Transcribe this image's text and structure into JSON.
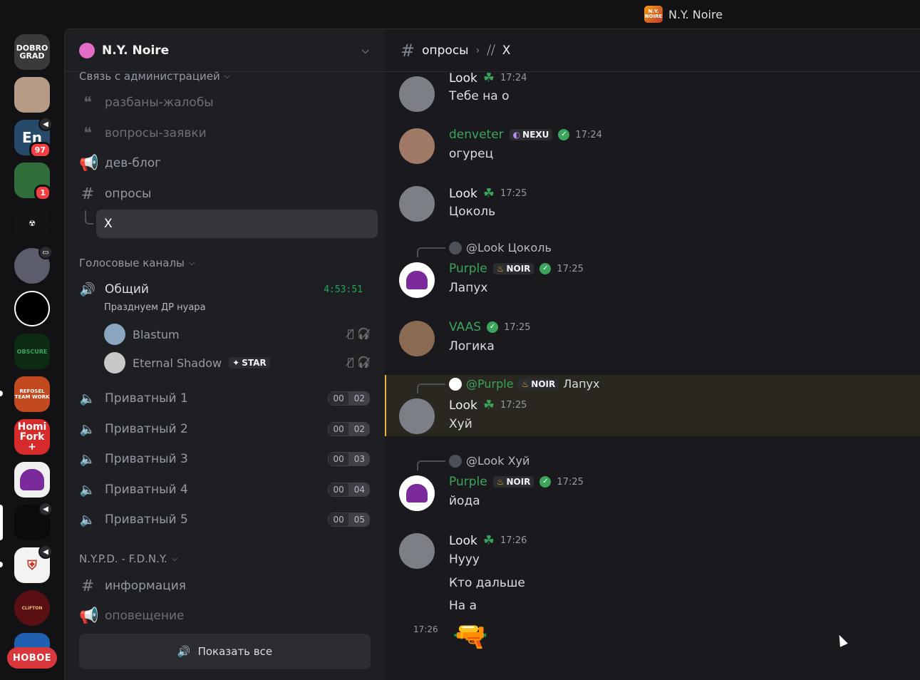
{
  "window": {
    "title": "N.Y. Noire"
  },
  "guilds": [
    {
      "label": "DOBRO GRAD",
      "color": "#3a3a3a"
    },
    {
      "label": "",
      "color": "#b59a86"
    },
    {
      "label": "En",
      "color": "#274a6b",
      "badge": "97",
      "speaker": true
    },
    {
      "label": "",
      "color": "#2f6d3a",
      "badge": "1"
    },
    {
      "label": "",
      "color": "#141414"
    },
    {
      "label": "",
      "color": "#5b5d6d",
      "speaker": true
    },
    {
      "label": "",
      "color": "#000000"
    },
    {
      "label": "OBSCURE",
      "color": "#0d2a12"
    },
    {
      "label": "REFOSEL TEAM WORK",
      "color": "#c34a1f"
    },
    {
      "label": "Homi Fork +",
      "color": "#d72b2b"
    },
    {
      "label": "",
      "color": "#f0f0f0"
    },
    {
      "label": "",
      "color": "#0b0b0b",
      "speaker": true
    },
    {
      "label": "",
      "color": "#f3f3f3",
      "speaker": true
    },
    {
      "label": "CLIFTON",
      "color": "#5a0f12"
    },
    {
      "label": "",
      "color": "#1f5fb0"
    }
  ],
  "new_button": "НОВОЕ",
  "server": {
    "name": "N.Y. Noire"
  },
  "categories": {
    "admin": "Связь с администрацией",
    "voice": "Голосовые каналы",
    "nypd": "N.Y.P.D. - F.D.N.Y."
  },
  "channels": {
    "unbans": "разбаны-жалобы",
    "requests": "вопросы-заявки",
    "devblog": "дев-блог",
    "polls": "опросы",
    "thread_x": "X",
    "info": "информация",
    "alerts": "оповещение"
  },
  "voice": {
    "general": {
      "name": "Общий",
      "timer": "4:53:51",
      "status": "Празднуем ДР нуара"
    },
    "users": [
      {
        "name": "Blastum"
      },
      {
        "name": "Eternal Shadow",
        "tag": "STAR"
      }
    ],
    "private": [
      {
        "name": "Приватный 1",
        "a": "00",
        "b": "02"
      },
      {
        "name": "Приватный 2",
        "a": "00",
        "b": "02"
      },
      {
        "name": "Приватный 3",
        "a": "00",
        "b": "03"
      },
      {
        "name": "Приватный 4",
        "a": "00",
        "b": "04"
      },
      {
        "name": "Приватный 5",
        "a": "00",
        "b": "05"
      }
    ]
  },
  "show_all": "Показать все",
  "chat": {
    "breadcrumb": {
      "channel": "опросы",
      "thread": "X"
    },
    "messages": [
      {
        "user": "Look",
        "time": "17:24",
        "text": "Тебе на о"
      },
      {
        "user": "denveter",
        "tag": "NEXU",
        "time": "17:24",
        "text": "огурец"
      },
      {
        "user": "Look",
        "time": "17:25",
        "text": "Цоколь"
      },
      {
        "reply": "@Look Цоколь",
        "user": "Purple",
        "tag": "NOIR",
        "time": "17:25",
        "text": "Лапух"
      },
      {
        "user": "VAAS",
        "time": "17:25",
        "text": "Логика"
      },
      {
        "reply_user": "@Purple",
        "reply_tag": "NOIR",
        "reply_text": "Лапух",
        "user": "Look",
        "time": "17:25",
        "text": "Хуй"
      },
      {
        "reply": "@Look Хуй",
        "user": "Purple",
        "tag": "NOIR",
        "time": "17:25",
        "text": "йода"
      },
      {
        "user": "Look",
        "time": "17:26",
        "text": "Нууу"
      },
      {
        "text": "Кто дальше"
      },
      {
        "text": "На а"
      },
      {
        "time": "17:26"
      }
    ]
  }
}
